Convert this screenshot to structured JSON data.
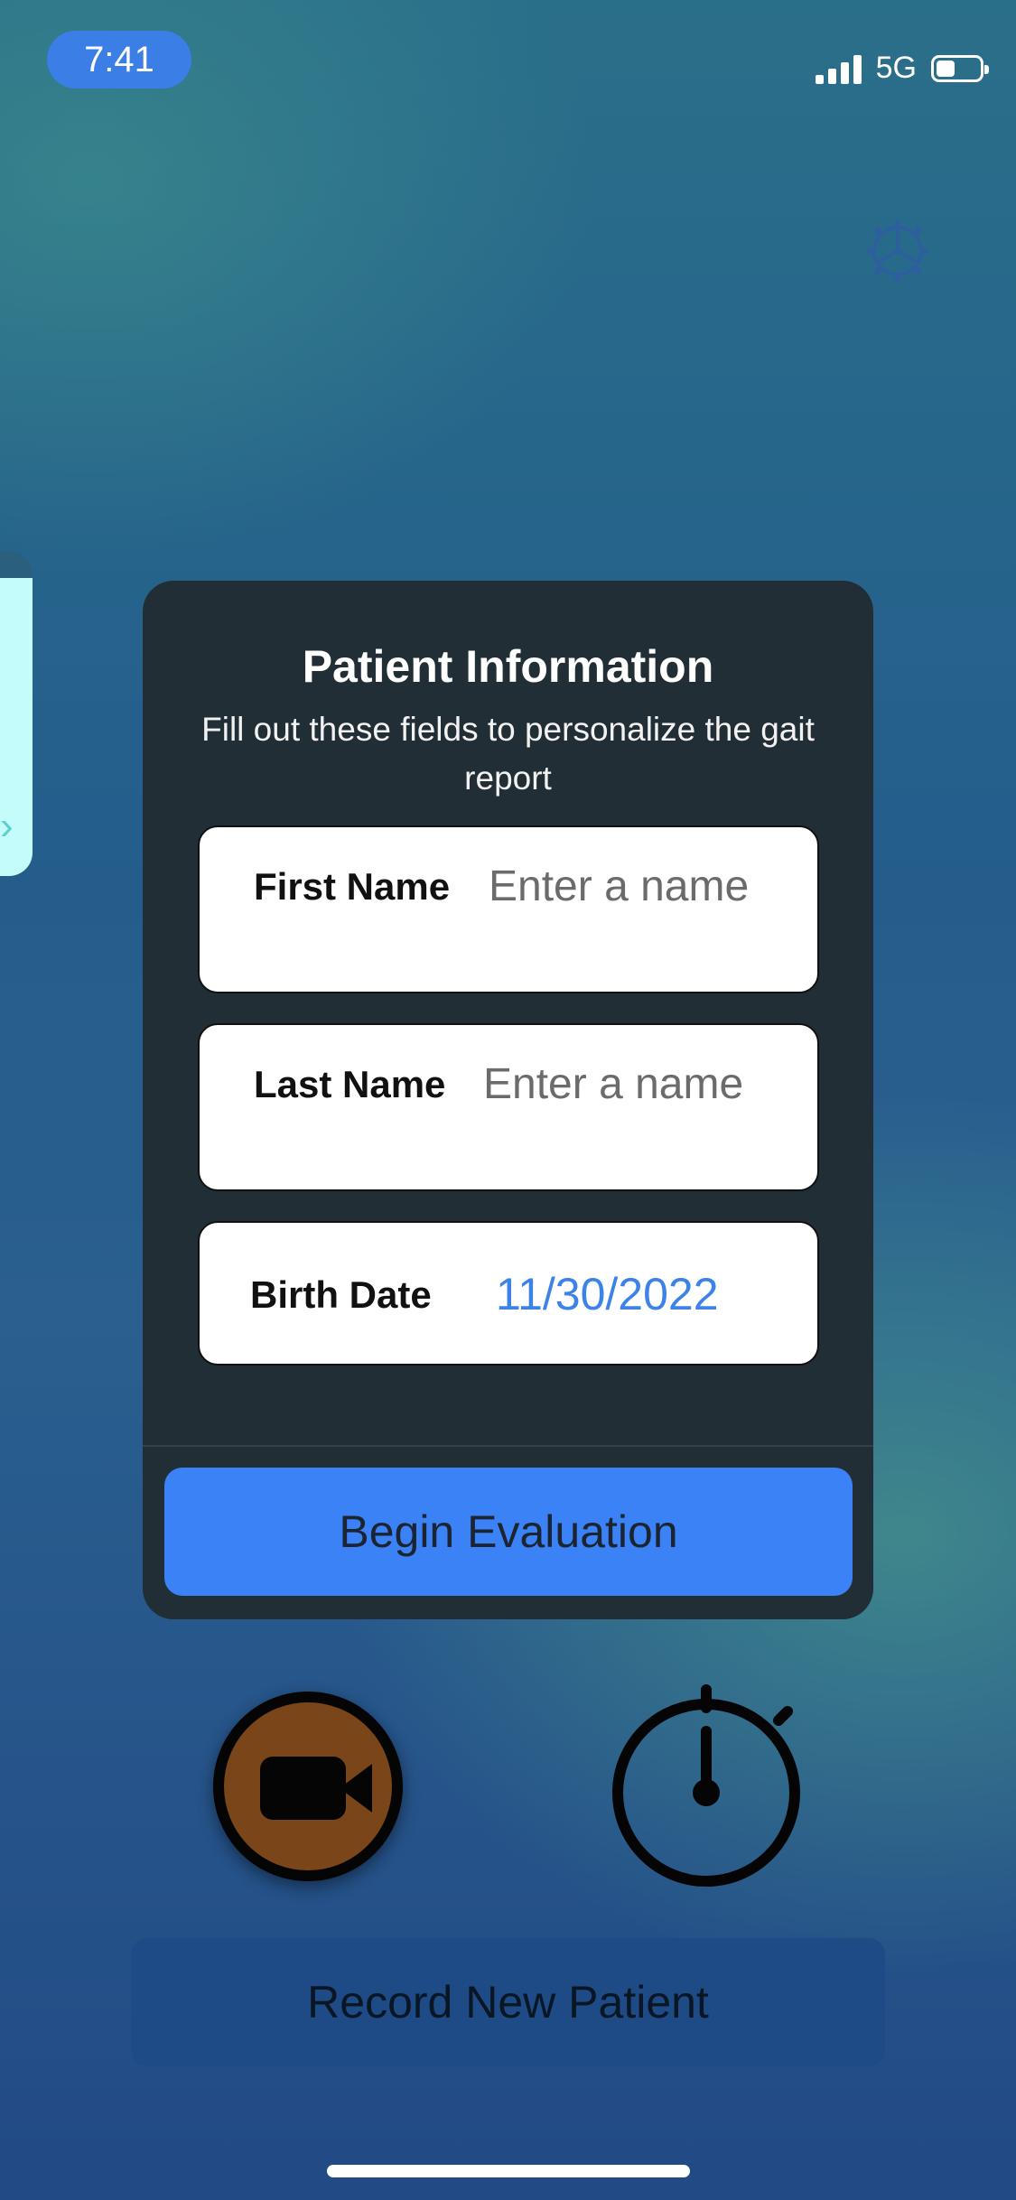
{
  "status_bar": {
    "time": "7:41",
    "network": "5G",
    "battery_percent": 35
  },
  "modal": {
    "title": "Patient Information",
    "subtitle": "Fill out these fields to personalize the gait report",
    "fields": {
      "first_name": {
        "label": "First Name",
        "value": "",
        "placeholder": "Enter a name"
      },
      "last_name": {
        "label": "Last Name",
        "value": "",
        "placeholder": "Enter a name"
      },
      "birth_date": {
        "label": "Birth Date",
        "value": "11/30/2022"
      }
    },
    "begin_button": "Begin Evaluation"
  },
  "record_button": "Record New Patient",
  "icons": {
    "settings": "gear-icon",
    "camera": "video-camera-icon",
    "timer": "stopwatch-icon",
    "side_card": "chevron-icon"
  }
}
